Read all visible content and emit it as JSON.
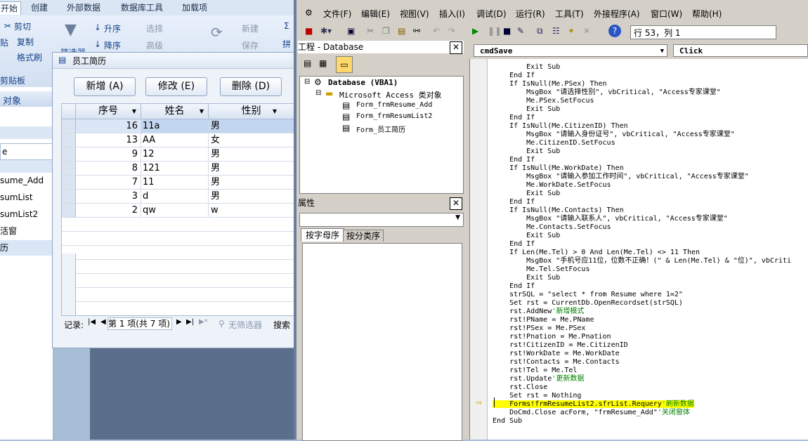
{
  "access": {
    "tabs": [
      "开始",
      "创建",
      "外部数据",
      "数据库工具",
      "加载项"
    ],
    "ribbon": {
      "cut": "剪切",
      "copy": "复制",
      "format_painter": "格式刷",
      "paste_fragment": "贴",
      "clipboard_group": "剪贴板",
      "asc": "升序",
      "desc": "降序",
      "filter_fragment": "筛选器",
      "select": "选择",
      "advanced": "高级",
      "new": "新建",
      "save": "保存",
      "sigma": "Σ",
      "extra": "拼"
    },
    "nav": {
      "header": "对象",
      "items": [
        "e",
        "sume_Add",
        "sumList",
        "sumList2",
        "活窗",
        "历"
      ]
    },
    "form": {
      "title": "员工简历",
      "buttons": {
        "add": "新增 (A)",
        "edit": "修改 (E)",
        "delete": "删除 (D)"
      },
      "columns": [
        "序号",
        "姓名",
        "性别"
      ],
      "rows": [
        {
          "id": "16",
          "name": "11a",
          "gender": "男"
        },
        {
          "id": "13",
          "name": "AA",
          "gender": "女"
        },
        {
          "id": "9",
          "name": "12",
          "gender": "男"
        },
        {
          "id": "8",
          "name": "121",
          "gender": "男"
        },
        {
          "id": "7",
          "name": "11",
          "gender": "男"
        },
        {
          "id": "3",
          "name": "d",
          "gender": "男"
        },
        {
          "id": "2",
          "name": "qw",
          "gender": "w"
        }
      ],
      "record_label": "记录:",
      "record_pos": "第 1 项(共 7 项)",
      "no_filter": "无筛选器",
      "search": "搜索"
    }
  },
  "vba": {
    "menu": [
      "文件(F)",
      "编辑(E)",
      "视图(V)",
      "插入(I)",
      "调试(D)",
      "运行(R)",
      "工具(T)",
      "外接程序(A)",
      "窗口(W)",
      "帮助(H)"
    ],
    "line_col": "行 53，列 1",
    "project": {
      "title": "工程 - Database",
      "root": "Database (VBA1)",
      "folder": "Microsoft Access 类对象",
      "items": [
        "Form_frmResume_Add",
        "Form_frmResumList2",
        "Form_员工简历"
      ]
    },
    "props": {
      "title": "属性",
      "tab1": "按字母序",
      "tab2": "按分类序"
    },
    "object_combo": "cmdSave",
    "proc_combo": "Click",
    "code": [
      {
        "text": "        Exit Sub"
      },
      {
        "text": "    End If"
      },
      {
        "text": "    If IsNull(Me.PSex) Then"
      },
      {
        "text": "        MsgBox \"请选择性别\", vbCritical, \"Access专家课堂\""
      },
      {
        "text": "        Me.PSex.SetFocus"
      },
      {
        "text": "        Exit Sub"
      },
      {
        "text": "    End If"
      },
      {
        "text": "    If IsNull(Me.CitizenID) Then"
      },
      {
        "text": "        MsgBox \"请输入身份证号\", vbCritical, \"Access专家课堂\""
      },
      {
        "text": "        Me.CitizenID.SetFocus"
      },
      {
        "text": "        Exit Sub"
      },
      {
        "text": "    End If"
      },
      {
        "text": "    If IsNull(Me.WorkDate) Then"
      },
      {
        "text": "        MsgBox \"请输入参加工作时间\", vbCritical, \"Access专家课堂\""
      },
      {
        "text": "        Me.WorkDate.SetFocus"
      },
      {
        "text": "        Exit Sub"
      },
      {
        "text": "    End If"
      },
      {
        "text": "    If IsNull(Me.Contacts) Then"
      },
      {
        "text": "        MsgBox \"请输入联系人\", vbCritical, \"Access专家课堂\""
      },
      {
        "text": "        Me.Contacts.SetFocus"
      },
      {
        "text": "        Exit Sub"
      },
      {
        "text": "    End If"
      },
      {
        "text": "    If Len(Me.Tel) > 0 And Len(Me.Tel) <> 11 Then"
      },
      {
        "text": "        MsgBox \"手机号应11位，位数不正确！(\" & Len(Me.Tel) & \"位)\", vbCriti"
      },
      {
        "text": "        Me.Tel.SetFocus"
      },
      {
        "text": "        Exit Sub"
      },
      {
        "text": "    End If"
      },
      {
        "text": "    strSQL = \"select * from Resume where 1=2\""
      },
      {
        "text": "    Set rst = CurrentDb.OpenRecordset(strSQL)"
      },
      {
        "text": "    rst.AddNew",
        "comment": "'新增模式"
      },
      {
        "text": "    rst!PName = Me.PName"
      },
      {
        "text": "    rst!PSex = Me.PSex"
      },
      {
        "text": "    rst!Pnation = Me.Pnation"
      },
      {
        "text": "    rst!CitizenID = Me.CitizenID"
      },
      {
        "text": "    rst!WorkDate = Me.WorkDate"
      },
      {
        "text": "    rst!Contacts = Me.Contacts"
      },
      {
        "text": "    rst!Tel = Me.Tel"
      },
      {
        "text": "    rst.Update",
        "comment": "'更新数据"
      },
      {
        "text": "    rst.Close"
      },
      {
        "text": "    Set rst = Nothing"
      },
      {
        "text": "    Forms!frmResumeList2.sfrList.Requery",
        "comment": "'刷新数据",
        "highlight": true
      },
      {
        "text": "    DoCmd.Close acForm, \"frmResume_Add\"",
        "comment": "'关闭窗体"
      },
      {
        "text": "End Sub"
      }
    ]
  }
}
